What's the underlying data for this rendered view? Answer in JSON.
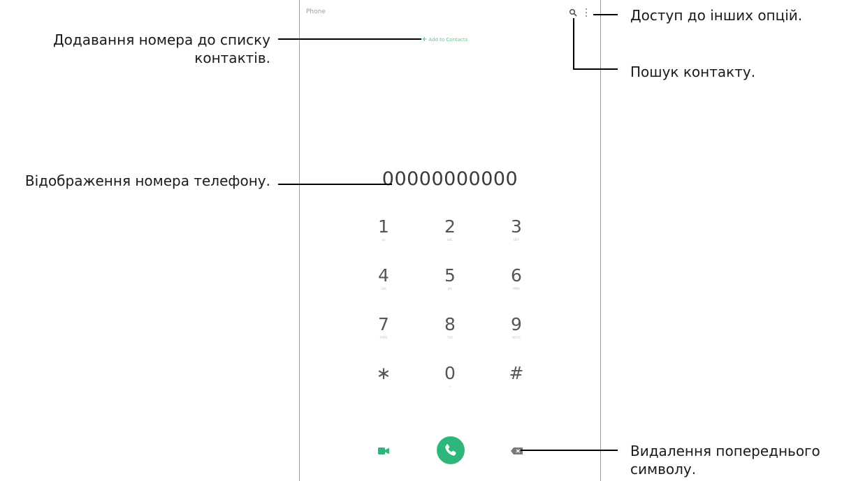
{
  "phone": {
    "app_title": "Phone",
    "add_contact_label": "Add to Contacts",
    "number_display": "00000000000",
    "keys": [
      {
        "digit": "1",
        "letters": "oo"
      },
      {
        "digit": "2",
        "letters": "ABC"
      },
      {
        "digit": "3",
        "letters": "DEF"
      },
      {
        "digit": "4",
        "letters": "GHI"
      },
      {
        "digit": "5",
        "letters": "JKL"
      },
      {
        "digit": "6",
        "letters": "MNO"
      },
      {
        "digit": "7",
        "letters": "PQRS"
      },
      {
        "digit": "8",
        "letters": "TUV"
      },
      {
        "digit": "9",
        "letters": "WXYZ"
      },
      {
        "digit": "∗",
        "letters": ""
      },
      {
        "digit": "0",
        "letters": "+"
      },
      {
        "digit": "#",
        "letters": ""
      }
    ],
    "icons": {
      "search": "search-icon",
      "more": "more-options-icon",
      "video": "video-call-icon",
      "call": "phone-icon",
      "backspace": "backspace-icon"
    }
  },
  "annotations": {
    "add_contact": "Додавання номера до списку контактів.",
    "number_display": "Відображення номера телефону.",
    "more_options": "Доступ до інших опцій.",
    "search": "Пошук контакту.",
    "backspace": "Видалення попереднього символу."
  },
  "colors": {
    "accent_green": "#2fb67a",
    "frame_gray": "#9c9c9c",
    "text_dark": "#1a1a1a"
  }
}
